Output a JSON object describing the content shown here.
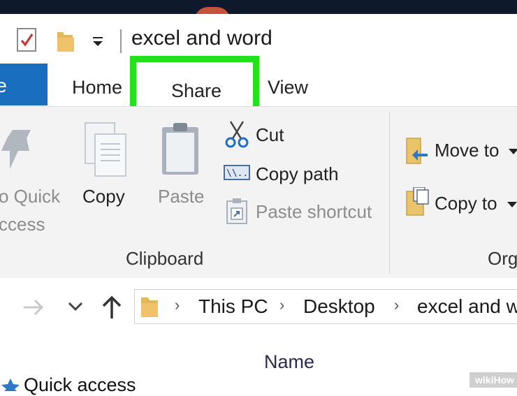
{
  "window": {
    "title": "excel and word"
  },
  "tabs": {
    "file_partial": "le",
    "home": "Home",
    "share": "Share",
    "view": "View"
  },
  "ribbon": {
    "pin_label_line1": "o Quick",
    "pin_label_line2": "ccess",
    "copy": "Copy",
    "paste": "Paste",
    "cut": "Cut",
    "copy_path": "Copy path",
    "paste_shortcut": "Paste shortcut",
    "clipboard_group": "Clipboard",
    "move_to": "Move to",
    "copy_to": "Copy to",
    "organize_partial": "Org"
  },
  "address": {
    "crumbs": [
      "This PC",
      "Desktop",
      "excel and w"
    ]
  },
  "content": {
    "column_name": "Name",
    "quick_access": "Quick access"
  },
  "watermark": "wikiHow",
  "colors": {
    "highlight": "#22e21b",
    "file_tab": "#1a6ec0",
    "ribbon_bg": "#f3f3f3"
  }
}
